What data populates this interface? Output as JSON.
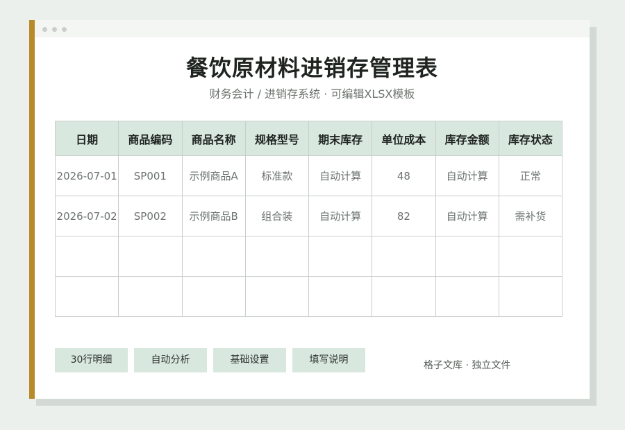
{
  "document": {
    "title": "餐饮原材料进销存管理表",
    "subtitle": "财务会计 / 进销存系统 · 可编辑XLSX模板"
  },
  "table": {
    "headers": [
      "日期",
      "商品编码",
      "商品名称",
      "规格型号",
      "期末库存",
      "单位成本",
      "库存金额",
      "库存状态"
    ],
    "rows": [
      [
        "2026-07-01",
        "SP001",
        "示例商品A",
        "标准款",
        "自动计算",
        "48",
        "自动计算",
        "正常"
      ],
      [
        "2026-07-02",
        "SP002",
        "示例商品B",
        "组合装",
        "自动计算",
        "82",
        "自动计算",
        "需补货"
      ],
      [
        "",
        "",
        "",
        "",
        "",
        "",
        "",
        ""
      ],
      [
        "",
        "",
        "",
        "",
        "",
        "",
        "",
        ""
      ]
    ]
  },
  "tags": [
    "30行明细",
    "自动分析",
    "基础设置",
    "填写说明"
  ],
  "footer": {
    "note": "格子文库 · 独立文件"
  },
  "colors": {
    "accent": "#b88a2a",
    "header_fill": "#d9e8df",
    "page_background": "#ecf0ec"
  }
}
